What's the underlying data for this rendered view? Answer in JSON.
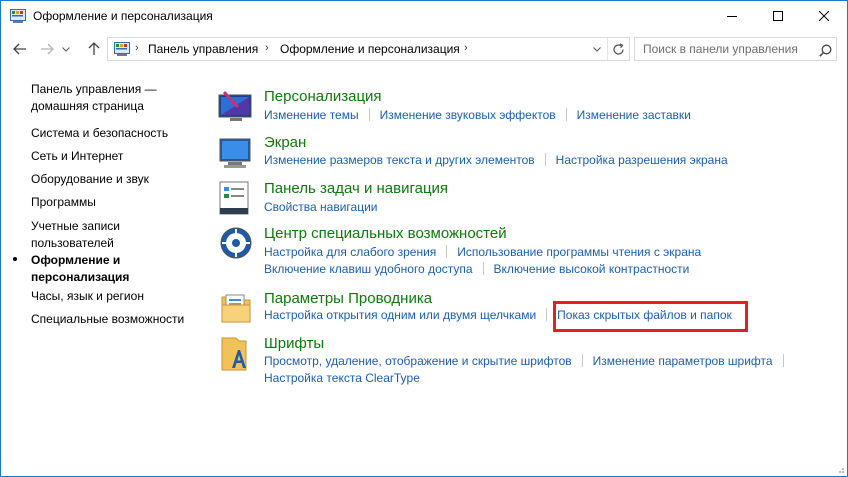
{
  "window": {
    "title": "Оформление и персонализация",
    "controls": {
      "minimize_icon": "minimize-icon",
      "maximize_icon": "maximize-icon",
      "close_icon": "close-icon"
    }
  },
  "address_bar": {
    "breadcrumbs": [
      "Панель управления",
      "Оформление и персонализация"
    ],
    "separator": "›"
  },
  "search": {
    "placeholder": "Поиск в панели управления"
  },
  "sidebar": {
    "items": [
      {
        "label_lines": [
          "Панель управления —",
          "домашняя страница"
        ],
        "current": false
      },
      {
        "label_lines": [
          "Система и безопасность"
        ],
        "current": false
      },
      {
        "label_lines": [
          "Сеть и Интернет"
        ],
        "current": false
      },
      {
        "label_lines": [
          "Оборудование и звук"
        ],
        "current": false
      },
      {
        "label_lines": [
          "Программы"
        ],
        "current": false
      },
      {
        "label_lines": [
          "Учетные записи",
          "пользователей"
        ],
        "current": false
      },
      {
        "label_lines": [
          "Оформление и",
          "персонализация"
        ],
        "current": true
      },
      {
        "label_lines": [
          "Часы, язык и регион"
        ],
        "current": false
      },
      {
        "label_lines": [
          "Специальные возможности"
        ],
        "current": false
      }
    ]
  },
  "categories": [
    {
      "title": "Персонализация",
      "icon": "personalization-icon",
      "link_rows": [
        [
          "Изменение темы",
          "Изменение звуковых эффектов",
          "Изменение заставки"
        ]
      ]
    },
    {
      "title": "Экран",
      "icon": "display-icon",
      "link_rows": [
        [
          "Изменение размеров текста и других элементов",
          "Настройка разрешения экрана"
        ]
      ]
    },
    {
      "title": "Панель задач и навигация",
      "icon": "taskbar-icon",
      "link_rows": [
        [
          "Свойства навигации"
        ]
      ]
    },
    {
      "title": "Центр специальных возможностей",
      "icon": "ease-of-access-icon",
      "link_rows": [
        [
          "Настройка для слабого зрения",
          "Использование программы чтения с экрана"
        ],
        [
          "Включение клавиш удобного доступа",
          "Включение высокой контрастности"
        ]
      ]
    },
    {
      "title": "Параметры Проводника",
      "icon": "explorer-options-icon",
      "link_rows": [
        [
          "Настройка открытия одним или двумя щелчками",
          "Показ скрытых файлов и папок"
        ]
      ]
    },
    {
      "title": "Шрифты",
      "icon": "fonts-icon",
      "link_rows": [
        [
          "Просмотр, удаление, отображение и скрытие шрифтов",
          "Изменение параметров шрифта"
        ],
        [
          "Настройка текста ClearType"
        ]
      ]
    }
  ],
  "colors": {
    "category_title": "#0d7a0d",
    "link": "#1a5fb4",
    "highlight": "#e31e24",
    "window_border": "#1979ca"
  }
}
